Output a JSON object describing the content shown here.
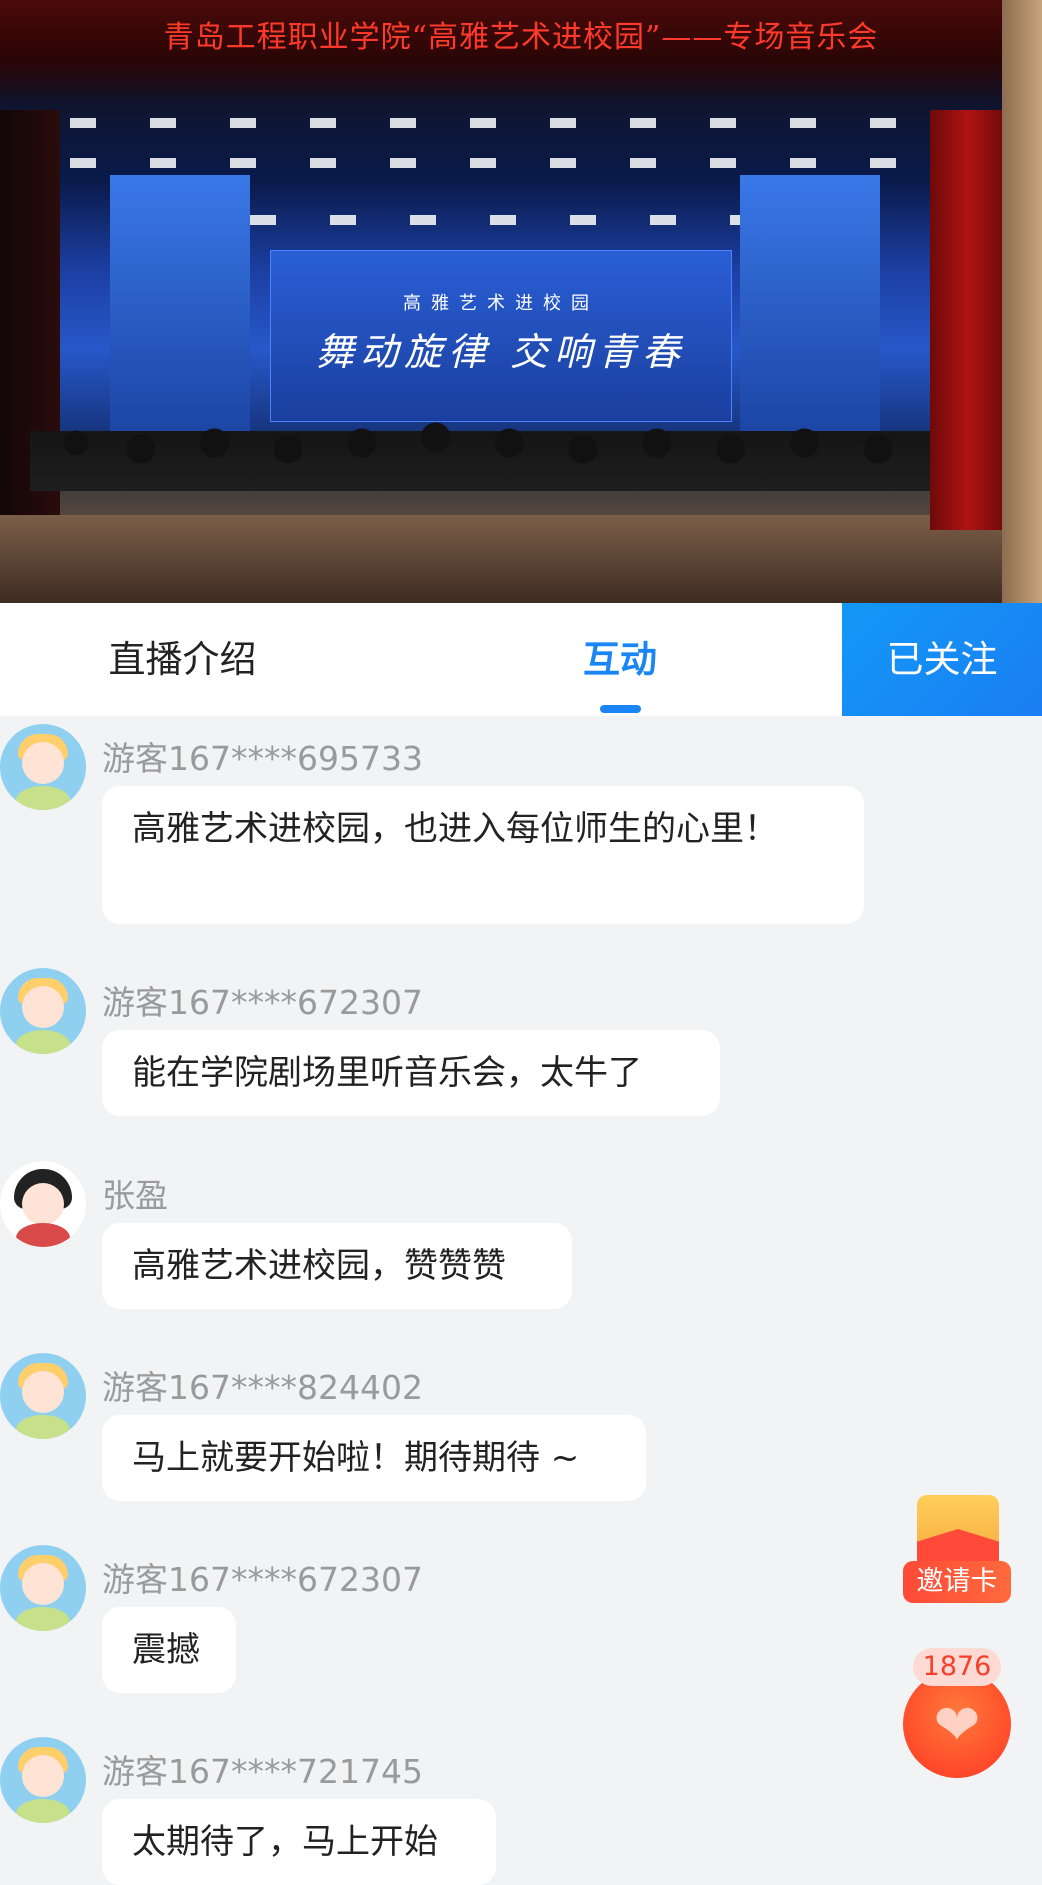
{
  "video": {
    "banner": "青岛工程职业学院“高雅艺术进校园”——专场音乐会",
    "screen_subtitle": "高雅艺术进校园",
    "screen_title": "舞动旋律  交响青春"
  },
  "tabs": {
    "intro_label": "直播介绍",
    "interact_label": "互动",
    "follow_label": "已关注"
  },
  "messages": [
    {
      "user": "游客167****695733",
      "text": "高雅艺术进校园，也进入每位师生的心里！",
      "avatar": "guest-avatar"
    },
    {
      "user": "游客167****672307",
      "text": "能在学院剧场里听音乐会，太牛了",
      "avatar": "guest-avatar"
    },
    {
      "user": "张盈",
      "text": "高雅艺术进校园，赞赞赞",
      "avatar": "girl-avatar"
    },
    {
      "user": "游客167****824402",
      "text": "马上就要开始啦！期待期待 ~",
      "avatar": "guest-avatar"
    },
    {
      "user": "游客167****672307",
      "text": "震撼",
      "avatar": "guest-avatar"
    },
    {
      "user": "游客167****721745",
      "text": "太期待了，马上开始",
      "avatar": "guest-avatar"
    }
  ],
  "widgets": {
    "invite_label": "邀请卡",
    "like_count": "1876"
  },
  "colors": {
    "accent": "#1a86f5",
    "like": "#ff4a2a",
    "banner_text": "#ff3a2a"
  }
}
